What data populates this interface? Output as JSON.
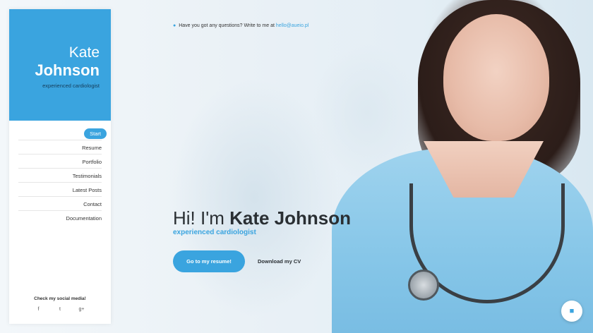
{
  "profile": {
    "first_name": "Kate",
    "last_name": "Johnson",
    "tagline": "experienced cardiologist"
  },
  "nav": {
    "items": [
      {
        "label": "Start",
        "active": true
      },
      {
        "label": "Resume"
      },
      {
        "label": "Portfolio"
      },
      {
        "label": "Testimonials"
      },
      {
        "label": "Latest Posts"
      },
      {
        "label": "Contact"
      },
      {
        "label": "Documentation"
      }
    ]
  },
  "social": {
    "title": "Check my social media!",
    "icons": [
      "facebook-icon",
      "twitter-icon",
      "google-plus-icon"
    ],
    "glyphs": [
      "f",
      "t",
      "g+"
    ]
  },
  "contact": {
    "text": "Have you got any questions? Write to me at",
    "email": "hello@aueio.pl"
  },
  "hero": {
    "greeting": "Hi! I'm",
    "name": "Kate Johnson",
    "subtitle": "experienced cardiologist",
    "primary_button": "Go to my resume!",
    "secondary_link": "Download my CV"
  },
  "colors": {
    "accent": "#3aa4df"
  }
}
